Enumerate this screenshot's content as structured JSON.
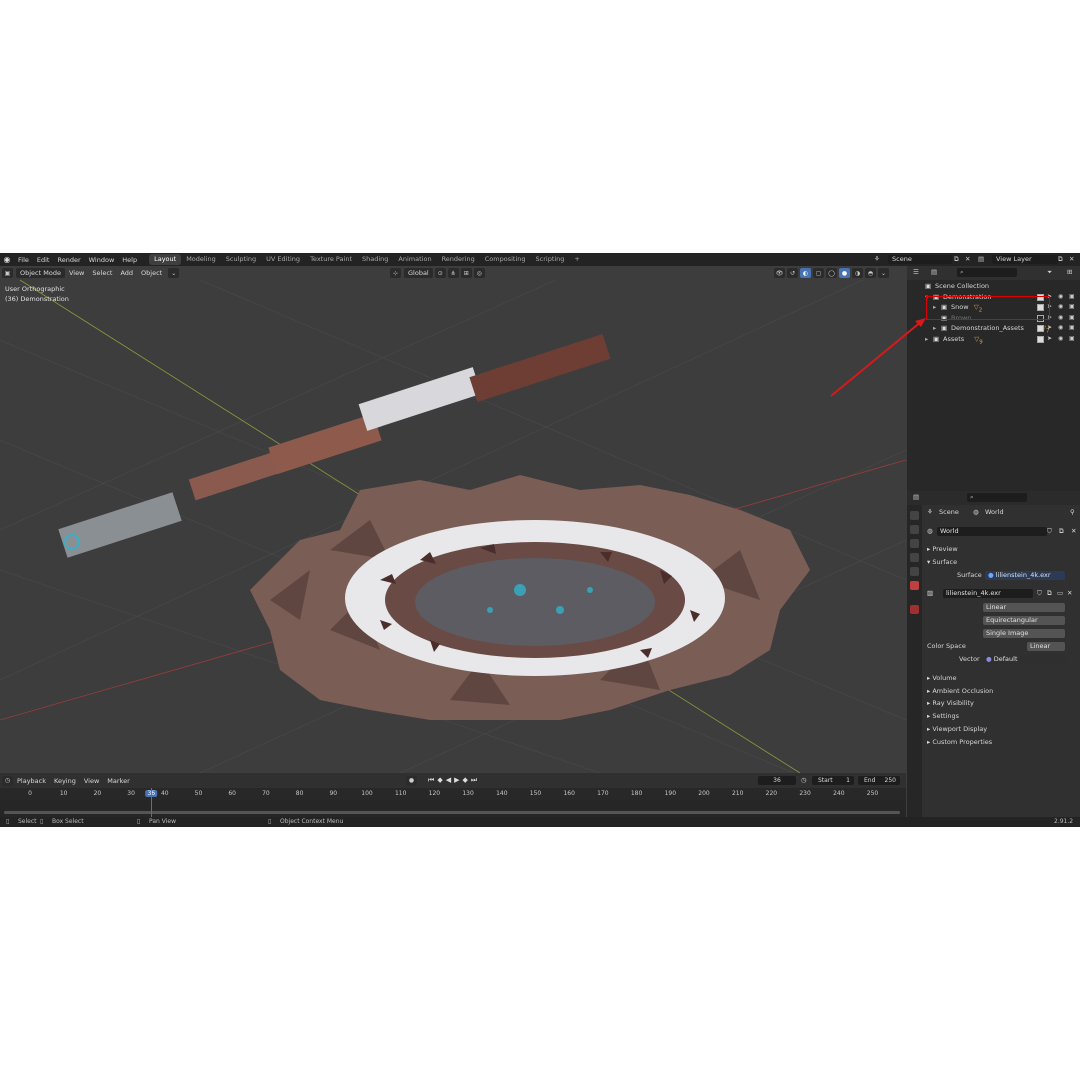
{
  "topbar": {
    "menus": [
      "File",
      "Edit",
      "Render",
      "Window",
      "Help"
    ],
    "workspaces": [
      "Layout",
      "Modeling",
      "Sculpting",
      "UV Editing",
      "Texture Paint",
      "Shading",
      "Animation",
      "Rendering",
      "Compositing",
      "Scripting"
    ],
    "active_workspace": "Layout",
    "add_tab": "+",
    "scene_name": "Scene",
    "view_layer": "View Layer"
  },
  "viewport_header": {
    "mode": "Object Mode",
    "menus": [
      "View",
      "Select",
      "Add",
      "Object"
    ],
    "transform_orientation": "Global"
  },
  "viewport": {
    "view_name": "User Orthographic",
    "collection_info": "(36) Demonstration"
  },
  "outliner": {
    "rows": [
      {
        "label": "Scene Collection",
        "indent": 0,
        "expand": ""
      },
      {
        "label": "Demonstration",
        "indent": 1,
        "expand": "▾"
      },
      {
        "label": "Snow",
        "indent": 2,
        "expand": "▸",
        "badge": "2"
      },
      {
        "label": "Brown",
        "indent": 2,
        "expand": "",
        "dim": true
      },
      {
        "label": "Demonstration_Assets",
        "indent": 2,
        "expand": "▸",
        "badge": "7"
      },
      {
        "label": "Assets",
        "indent": 1,
        "expand": "▸",
        "badge": "9"
      }
    ]
  },
  "properties": {
    "breadcrumb_scene": "Scene",
    "breadcrumb_world": "World",
    "world_name": "World",
    "preview_label": "Preview",
    "surface_label": "Surface",
    "surface_field_label": "Surface",
    "surface_value": "lilienstein_4k.exr",
    "image_name": "lilienstein_4k.exr",
    "interpolation": "Linear",
    "projection": "Equirectangular",
    "source": "Single Image",
    "color_space_label": "Color Space",
    "color_space": "Linear",
    "vector_label": "Vector",
    "vector_value": "Default",
    "sections": [
      "Volume",
      "Ambient Occlusion",
      "Ray Visibility",
      "Settings",
      "Viewport Display",
      "Custom Properties"
    ]
  },
  "timeline": {
    "menus": [
      "Playback",
      "Keying",
      "View",
      "Marker"
    ],
    "current_frame": "36",
    "start_label": "Start",
    "start_value": "1",
    "end_label": "End",
    "end_value": "250",
    "ticks": [
      "0",
      "10",
      "20",
      "30",
      "36",
      "40",
      "50",
      "60",
      "70",
      "80",
      "90",
      "100",
      "110",
      "120",
      "130",
      "140",
      "150",
      "160",
      "170",
      "180",
      "190",
      "200",
      "210",
      "220",
      "230",
      "240",
      "250"
    ]
  },
  "statusbar": {
    "select": "Select",
    "box_select": "Box Select",
    "pan_view": "Pan View",
    "context_menu": "Object Context Menu",
    "version": "2.91.2"
  },
  "colors": {
    "accent": "#4772b3",
    "highlight_box": "#e00000",
    "background": "#3d3d3d"
  }
}
